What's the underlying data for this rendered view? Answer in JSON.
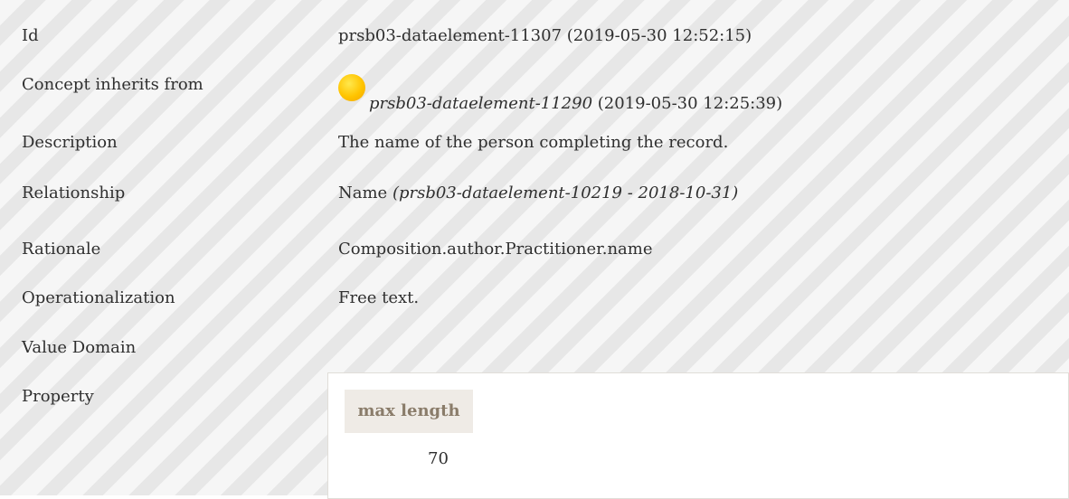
{
  "rows": [
    {
      "label": "Id",
      "value": "prsb03-dataelement-11307 (2019-05-30 12:52:15)"
    },
    {
      "label": "Concept inherits from",
      "link": "prsb03-dataelement-11290",
      "value": " (2019-05-30 12:25:39)"
    },
    {
      "label": "Description",
      "value": "The name of the person completing the record."
    },
    {
      "label": "Relationship",
      "value": "Name ",
      "italic": "(prsb03-dataelement-10219 - 2018-10-31)"
    },
    {
      "label": "Rationale",
      "value": "Composition.author.Practitioner.name"
    },
    {
      "label": "Operationalization",
      "value": "Free text."
    },
    {
      "label": "Value Domain",
      "value": ""
    },
    {
      "label": "Property",
      "value": ""
    }
  ],
  "property": {
    "header": "max length",
    "value": "70"
  },
  "colors": {
    "dot": "#ffc400",
    "header_bg": "#efebe6",
    "header_text": "#8a7c6a"
  }
}
